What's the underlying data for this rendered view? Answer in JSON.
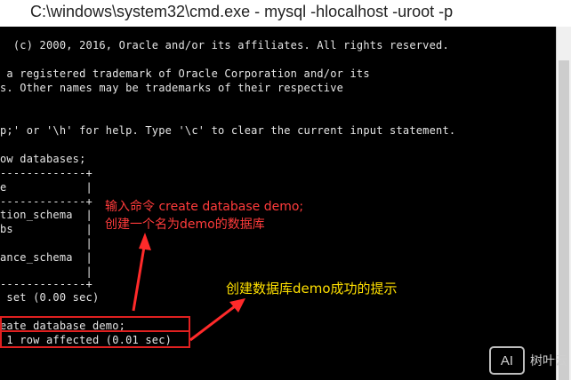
{
  "window": {
    "title": "C:\\windows\\system32\\cmd.exe - mysql  -hlocalhost -uroot -p"
  },
  "console": {
    "lines": [
      "  (c) 2000, 2016, Oracle and/or its affiliates. All rights reserved.",
      " a registered trademark of Oracle Corporation and/or its",
      "s. Other names may be trademarks of their respective",
      "p;' or '\\h' for help. Type '\\c' to clear the current input statement.",
      "ow databases;",
      "-------------+",
      "e            |",
      "-------------+",
      "tion_schema  |",
      "bs           |",
      "             |",
      "ance_schema  |",
      "             |",
      "-------------+",
      " set (0.00 sec)",
      "eate database demo;",
      " 1 row affected (0.01 sec)"
    ]
  },
  "annotations": {
    "command_hint_line1": "输入命令 create database demo;",
    "command_hint_line2": "创建一个名为demo的数据库",
    "success_hint": "创建数据库demo成功的提示"
  },
  "watermark": {
    "logo": "AI",
    "text": "树叶云"
  },
  "colors": {
    "console_bg": "#000000",
    "console_text": "#e6e6e6",
    "annotation_red": "#ff3b3b",
    "annotation_yellow": "#ffe000",
    "highlight_border": "#e02020"
  }
}
